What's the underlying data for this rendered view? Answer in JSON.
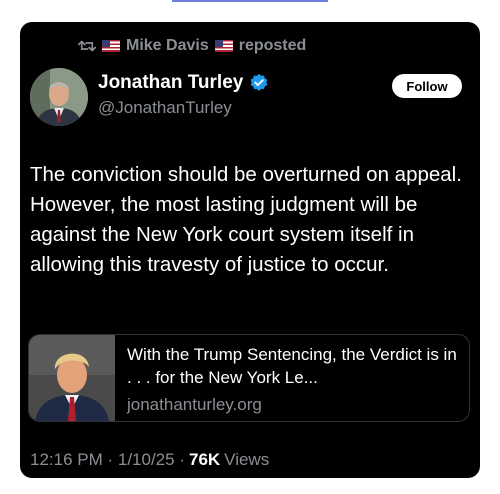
{
  "repost": {
    "icon": "retweet-icon",
    "user": "Mike Davis",
    "label": "reposted"
  },
  "author": {
    "name": "Jonathan Turley",
    "handle": "@JonathanTurley",
    "verified_color": "#1d9bf0"
  },
  "follow_label": "Follow",
  "post": {
    "text": "The conviction should be overturned on appeal. However, the most lasting judgment will be against the New York court system itself in allowing this travesty of justice to occur."
  },
  "link_card": {
    "title": "With the Trump Sentencing, the Verdict is in . . . for the New York Le...",
    "domain": "jonathanturley.org"
  },
  "meta": {
    "timestamp": "12:16 PM · 1/10/25 ·",
    "views_count": "76K",
    "views_label": "Views"
  }
}
